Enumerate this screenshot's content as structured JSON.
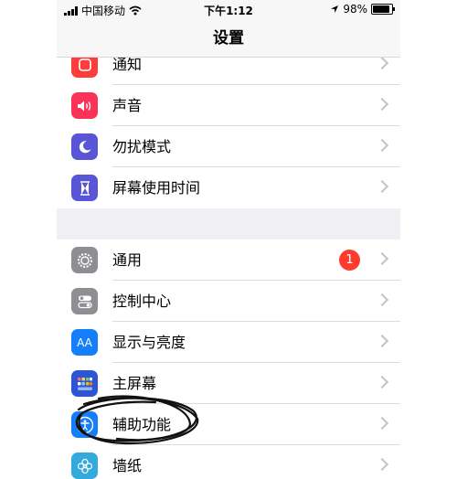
{
  "status": {
    "carrier": "中国移动",
    "time": "下午1:12",
    "battery": "98%",
    "battery_level": 0.98,
    "icons": [
      "signal-icon",
      "wifi-icon",
      "location-icon",
      "battery-icon"
    ]
  },
  "nav": {
    "title": "设置"
  },
  "group1": {
    "items": [
      {
        "label": "通知",
        "icon": "notifications-icon",
        "color": "#fc3d39"
      },
      {
        "label": "声音",
        "icon": "sound-icon",
        "color": "#fc3158"
      },
      {
        "label": "勿扰模式",
        "icon": "moon-icon",
        "color": "#5856d6"
      },
      {
        "label": "屏幕使用时间",
        "icon": "hourglass-icon",
        "color": "#5856d6"
      }
    ]
  },
  "group2": {
    "items": [
      {
        "label": "通用",
        "icon": "gear-icon",
        "color": "#8e8e93",
        "badge": "1"
      },
      {
        "label": "控制中心",
        "icon": "toggles-icon",
        "color": "#8e8e93"
      },
      {
        "label": "显示与亮度",
        "icon": "text-size-icon",
        "color": "#147efb",
        "glyph": "AA"
      },
      {
        "label": "主屏幕",
        "icon": "home-screen-icon",
        "color": "#2d56d4"
      },
      {
        "label": "辅助功能",
        "icon": "accessibility-icon",
        "color": "#147efb"
      },
      {
        "label": "墙纸",
        "icon": "wallpaper-icon",
        "color": "#34aadc"
      }
    ]
  }
}
